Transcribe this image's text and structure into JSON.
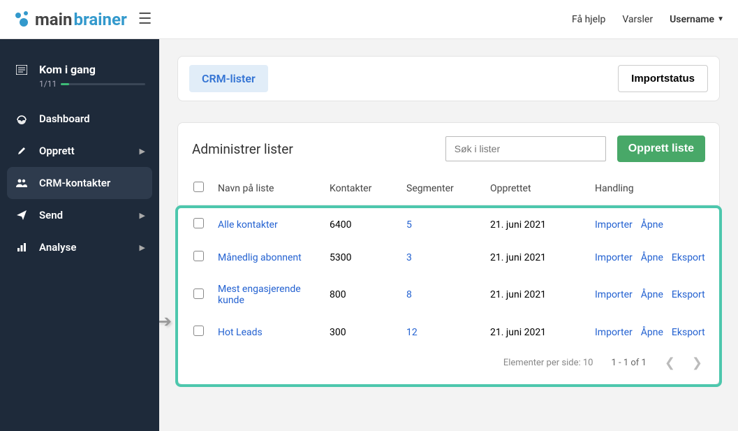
{
  "topbar": {
    "help": "Få hjelp",
    "alerts": "Varsler",
    "username": "Username"
  },
  "logo": {
    "part1": "main",
    "part2": "brainer"
  },
  "sidebar": {
    "getting_started": {
      "label": "Kom i gang",
      "progress_text": "1/11"
    },
    "items": [
      {
        "label": "Dashboard",
        "chevron": false
      },
      {
        "label": "Opprett",
        "chevron": true
      },
      {
        "label": "CRM-kontakter",
        "chevron": false,
        "active": true
      },
      {
        "label": "Send",
        "chevron": true
      },
      {
        "label": "Analyse",
        "chevron": true
      }
    ]
  },
  "tabs": {
    "active": "CRM-lister",
    "import_status": "Importstatus"
  },
  "list": {
    "title": "Administrer lister",
    "search_placeholder": "Søk i lister",
    "create": "Opprett liste"
  },
  "columns": {
    "name": "Navn på liste",
    "contacts": "Kontakter",
    "segments": "Segmenter",
    "created": "Opprettet",
    "actions": "Handling"
  },
  "actions": {
    "import": "Importer",
    "open": "Åpne",
    "export": "Eksport"
  },
  "rows": [
    {
      "name": "Alle kontakter",
      "contacts": "6400",
      "segments": "5",
      "created": "21. juni 2021",
      "export": false
    },
    {
      "name": "Månedlig abonnent",
      "contacts": "5300",
      "segments": "3",
      "created": "21. juni 2021",
      "export": true
    },
    {
      "name": "Mest engasjerende kunde",
      "contacts": "800",
      "segments": "8",
      "created": "21. juni 2021",
      "export": true
    },
    {
      "name": "Hot Leads",
      "contacts": "300",
      "segments": "12",
      "created": "21. juni 2021",
      "export": true
    }
  ],
  "pager": {
    "items_per_page": "Elementer per side: 10",
    "range": "1 - 1 of 1"
  }
}
